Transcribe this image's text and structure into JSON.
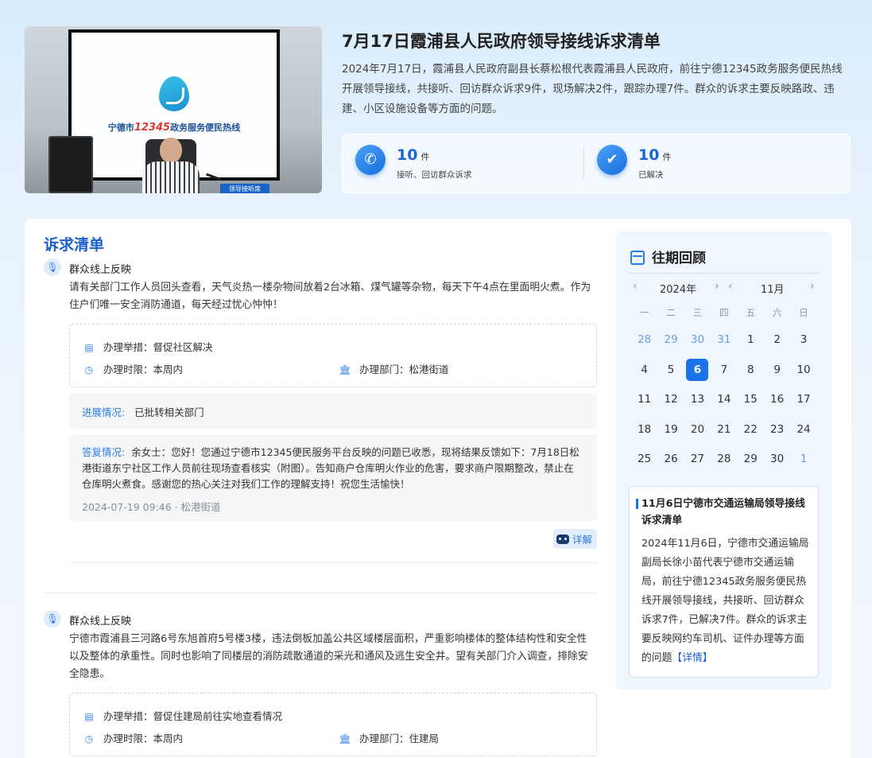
{
  "hero": {
    "image_screen_text_prefix": "宁德市",
    "image_screen_text_number": "12345",
    "image_screen_text_suffix": "政务服务便民热线",
    "image_sign": "领导接听席",
    "title": "7月17日霞浦县人民政府领导接线诉求清单",
    "description": "2024年7月17日，霞浦县人民政府副县长蔡松根代表霞浦县人民政府，前往宁德12345政务服务便民热线开展领导接线，共接听、回访群众诉求9件，现场解决2件，跟踪办理7件。群众的诉求主要反映路政、违建、小区设施设备等方面的问题。",
    "stats": [
      {
        "icon": "phone-icon",
        "number": "10",
        "unit": "件",
        "label": "接听、回访群众诉求"
      },
      {
        "icon": "check-icon",
        "number": "10",
        "unit": "件",
        "label": "已解决"
      }
    ]
  },
  "list": {
    "title": "诉求清单",
    "items": [
      {
        "source": "群众线上反映",
        "content": "请有关部门工作人员回头查看，天气炎热一楼杂物间放着2台冰箱、煤气罐等杂物，每天下午4点在里面明火煮。作为住户们唯一安全消防通道，每天经过忧心忡忡！",
        "measure_label": "办理举措：",
        "measure": "督促社区解决",
        "deadline_label": "办理时限：",
        "deadline": "本周内",
        "dept_label": "办理部门：",
        "dept": "松港街道",
        "progress_label": "进展情况:",
        "progress": "已批转相关部门",
        "reply_label": "答复情况:",
        "reply": "余女士：您好！您通过宁德市12345便民服务平台反映的问题已收悉，现将结果反馈如下：7月18日松港街道东宁社区工作人员前往现场查看核实（附图）。告知商户仓库明火作业的危害，要求商户限期整改，禁止在仓库明火煮食。感谢您的热心关注对我们工作的理解支持！祝您生活愉快！",
        "reply_meta": "2024-07-19 09:46 · 松港街道",
        "detail_button": "详解"
      },
      {
        "source": "群众线上反映",
        "content": "宁德市霞浦县三河路6号东旭首府5号楼3楼，违法倒板加盖公共区域楼层面积，严重影响楼体的整体结构性和安全性以及整体的承重性。同时也影响了同楼层的消防疏散通道的采光和通风及逃生安全井。望有关部门介入调查，排除安全隐患。",
        "measure_label": "办理举措：",
        "measure": "督促住建局前往实地查看情况",
        "deadline_label": "办理时限：",
        "deadline": "本周内",
        "dept_label": "办理部门：",
        "dept": "住建局"
      }
    ]
  },
  "sidebar": {
    "title": "往期回顾",
    "year": "2024年",
    "month": "11月",
    "weekdays": [
      "一",
      "二",
      "三",
      "四",
      "五",
      "六",
      "日"
    ],
    "weeks": [
      [
        "28",
        "29",
        "30",
        "31",
        "1",
        "2",
        "3"
      ],
      [
        "4",
        "5",
        "6",
        "7",
        "8",
        "9",
        "10"
      ],
      [
        "11",
        "12",
        "13",
        "14",
        "15",
        "16",
        "17"
      ],
      [
        "18",
        "19",
        "20",
        "21",
        "22",
        "23",
        "24"
      ],
      [
        "25",
        "26",
        "27",
        "28",
        "29",
        "30",
        "1"
      ]
    ],
    "selected_day": "6",
    "news": {
      "title": "11月6日宁德市交通运输局领导接线诉求清单",
      "body": "2024年11月6日，宁德市交通运输局副局长徐小苗代表宁德市交通运输局，前往宁德12345政务服务便民热线开展领导接线，共接听、回访群众诉求7件，已解决7件。群众的诉求主要反映网约车司机、证件办理等方面的问题",
      "link": "【详情】"
    }
  },
  "colors": {
    "accent": "#1a73e8",
    "title_blue": "#1b5fc8",
    "label_blue": "#2d7be5"
  }
}
